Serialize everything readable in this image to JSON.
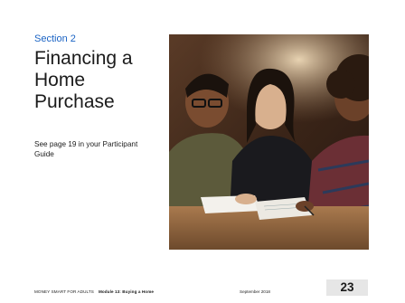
{
  "slide": {
    "section": "Section 2",
    "title": "Financing a Home Purchase",
    "subtitle": "See page 19 in your Participant Guide",
    "photo_icon": "people-signing-documents-photo",
    "footer": {
      "program": "MONEY SMART FOR ADULTS",
      "module": "Module 13: Buying a Home",
      "date": "September 2018",
      "page": "23"
    },
    "colors": {
      "section_label": "#1a63c4",
      "page_box": "#e6e6e6"
    }
  }
}
